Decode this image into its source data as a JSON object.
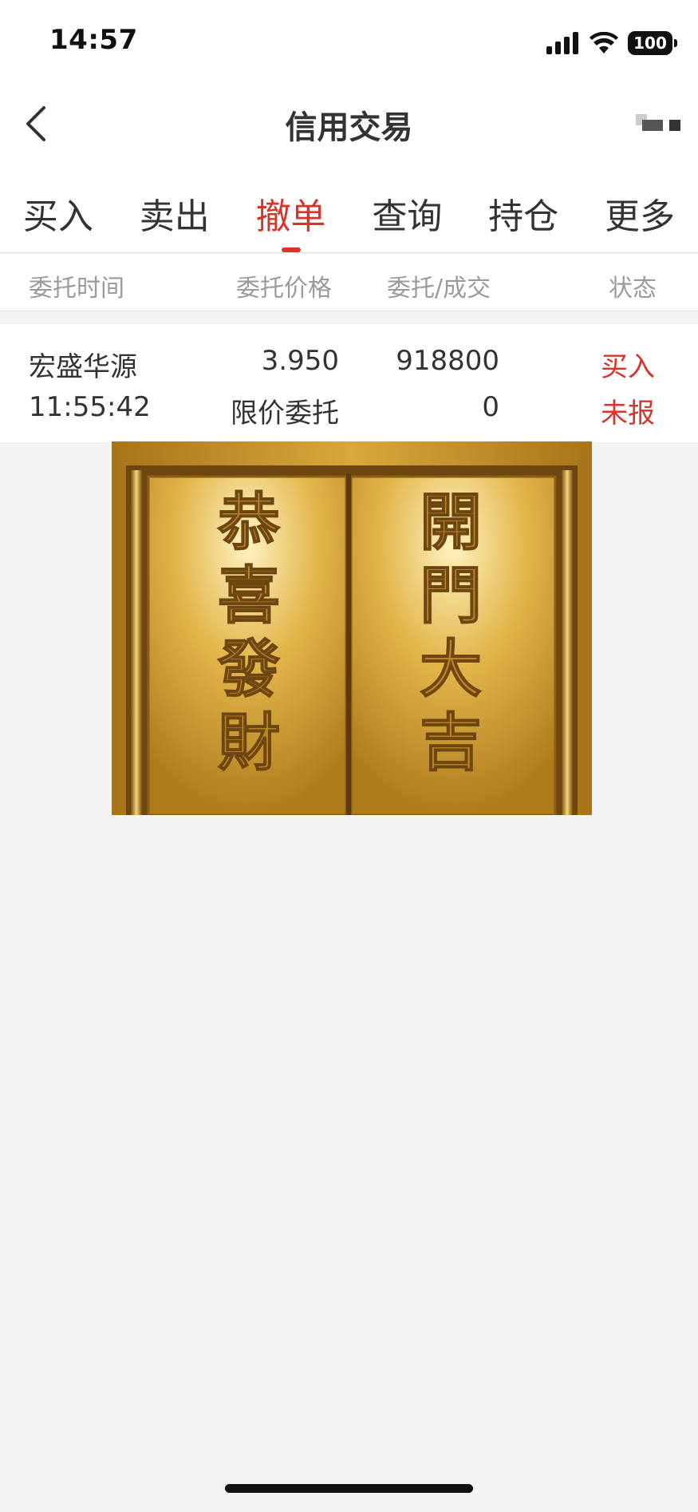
{
  "status_bar": {
    "time": "14:57",
    "battery": "100"
  },
  "nav": {
    "title": "信用交易"
  },
  "tabs": [
    {
      "label": "买入",
      "active": false
    },
    {
      "label": "卖出",
      "active": false
    },
    {
      "label": "撤单",
      "active": true
    },
    {
      "label": "查询",
      "active": false
    },
    {
      "label": "持仓",
      "active": false
    },
    {
      "label": "更多",
      "active": false
    }
  ],
  "table": {
    "headers": [
      "委托时间",
      "委托价格",
      "委托/成交",
      "状态"
    ],
    "orders": [
      {
        "name": "宏盛华源",
        "time": "11:55:42",
        "price": "3.950",
        "order_type": "限价委托",
        "order_qty": "918800",
        "filled_qty": "0",
        "direction": "买入",
        "status": "未报"
      }
    ]
  },
  "banner": {
    "left_panel": [
      "恭",
      "喜",
      "發",
      "財"
    ],
    "right_panel": [
      "開",
      "門",
      "大",
      "吉"
    ]
  },
  "colors": {
    "accent": "#d8352a",
    "gold": "#c9a43a"
  }
}
